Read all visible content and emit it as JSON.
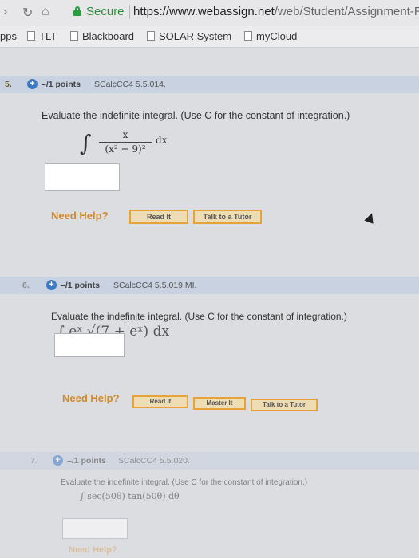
{
  "browser": {
    "secure_label": "Secure",
    "url_main": "https://www.webassign.net",
    "url_rest": "/web/Student/Assignment-Re",
    "bookmarks": [
      {
        "label": "pps"
      },
      {
        "label": "TLT"
      },
      {
        "label": "Blackboard"
      },
      {
        "label": "SOLAR System"
      },
      {
        "label": "myCloud"
      }
    ]
  },
  "questions": [
    {
      "number": "5.",
      "points": "–/1 points",
      "ref": "SCalcCC4 5.5.014.",
      "prompt": "Evaluate the indefinite integral. (Use C for the constant of integration.)",
      "math_num": "x",
      "math_den": "(x² + 9)²",
      "math_dx": "dx",
      "help": "Need Help?",
      "buttons": [
        "Read It",
        "Talk to a Tutor"
      ]
    },
    {
      "number": "6.",
      "points": "–/1 points",
      "ref": "SCalcCC4 5.5.019.MI.",
      "prompt": "Evaluate the indefinite integral. (Use C for the constant of integration.)",
      "math": "∫ eˣ √(7 + eˣ) dx",
      "help": "Need Help?",
      "buttons": [
        "Read It",
        "Master It",
        "Talk to a Tutor"
      ]
    },
    {
      "number": "7.",
      "points": "–/1 points",
      "ref": "SCalcCC4 5.5.020.",
      "prompt": "Evaluate the indefinite integral. (Use C for the constant of integration.)",
      "math": "∫ sec(50θ) tan(50θ) dθ",
      "help": "Need Help?"
    }
  ]
}
